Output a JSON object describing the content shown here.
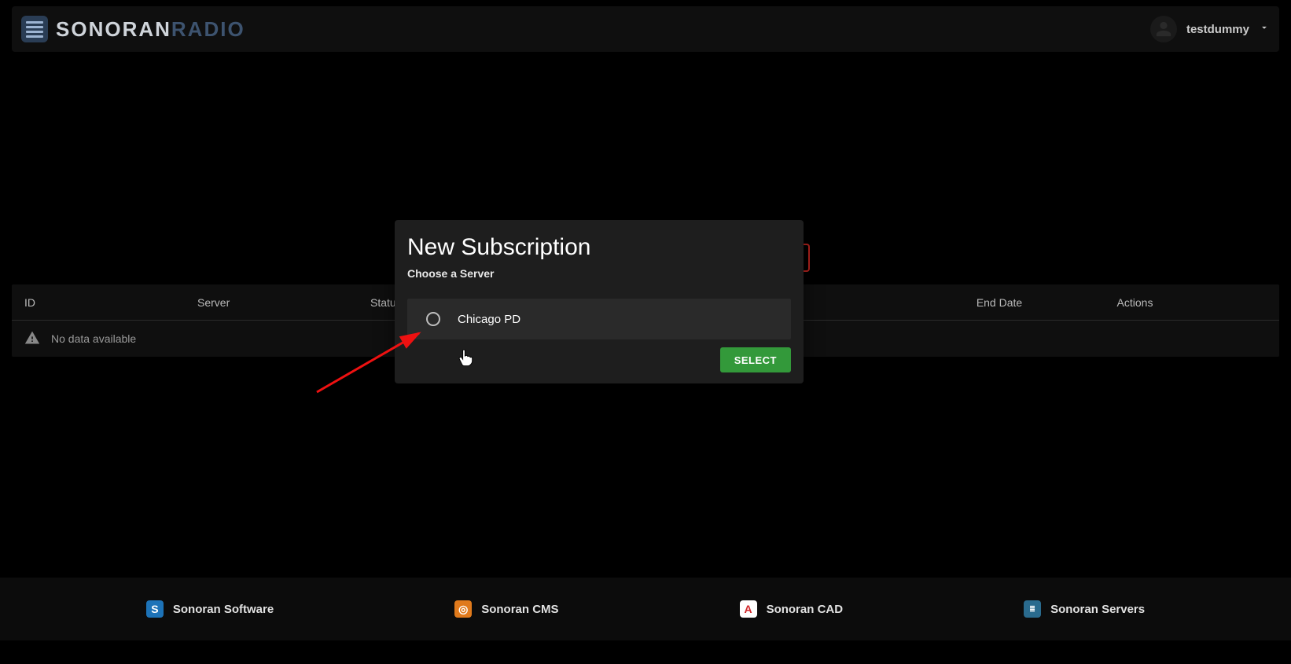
{
  "header": {
    "brand_primary": "SONORAN",
    "brand_secondary": "RADIO",
    "user_name": "testdummy"
  },
  "table": {
    "columns": {
      "id": "ID",
      "server": "Server",
      "status": "Status",
      "end_date": "End Date",
      "actions": "Actions"
    },
    "no_data_label": "No data available"
  },
  "modal": {
    "title": "New Subscription",
    "subtitle": "Choose a Server",
    "options": [
      {
        "label": "Chicago PD"
      }
    ],
    "select_button": "SELECT"
  },
  "footer": {
    "links": [
      {
        "label": "Sonoran Software",
        "icon": "S",
        "icon_class": "blue"
      },
      {
        "label": "Sonoran CMS",
        "icon": "◎",
        "icon_class": "orange"
      },
      {
        "label": "Sonoran CAD",
        "icon": "A",
        "icon_class": "red"
      },
      {
        "label": "Sonoran Servers",
        "icon": "≣",
        "icon_class": "teal"
      }
    ]
  }
}
